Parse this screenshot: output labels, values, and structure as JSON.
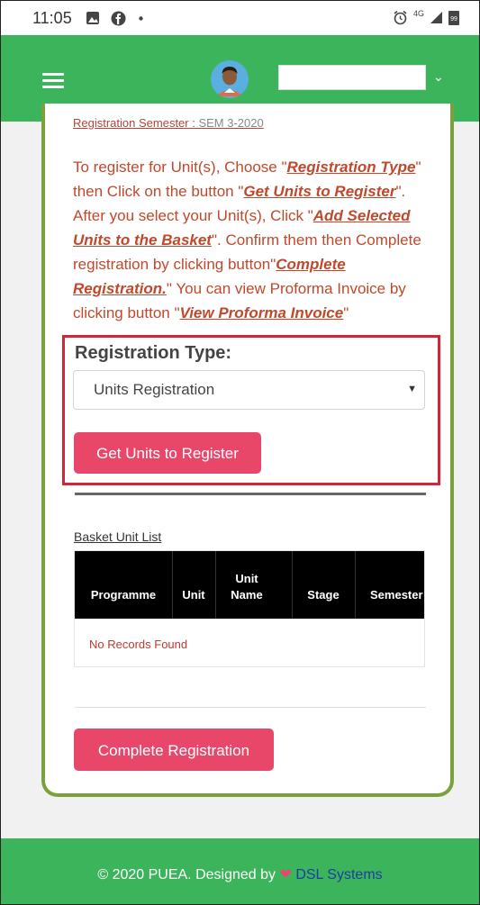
{
  "status_bar": {
    "time": "11:05",
    "network": "4G",
    "battery": "99",
    "icons": [
      "image-icon",
      "facebook-icon",
      "dot-icon",
      "alarm-icon",
      "signal-icon",
      "battery-icon"
    ]
  },
  "header": {
    "menu_icon": "hamburger-icon",
    "avatar_icon": "avatar-icon",
    "dropdown_icon": "chevron-down-icon",
    "user_value": ""
  },
  "registration": {
    "semester_label": "Registration Semester :",
    "semester_value": "SEM 3-2020",
    "instructions": {
      "p1": "To register for Unit(s), Choose \"",
      "link1": "Registration Type",
      "p2": "\" then Click on the button \"",
      "link2": "Get Units to Register",
      "p3": "\". After you select your Unit(s), Click \"",
      "link3": "Add Selected Units to the Basket",
      "p4": "\". Confirm them then Complete registration by clicking button\"",
      "link4": "Complete Registration.",
      "p5": "\" You can view Proforma Invoice by clicking button \"",
      "link5": "View Proforma Invoice",
      "p6": "\""
    },
    "type_label": "Registration Type:",
    "type_selected": "Units Registration",
    "get_units_button": "Get Units to Register"
  },
  "basket": {
    "title": "Basket Unit List",
    "columns": [
      "Programme",
      "Unit",
      "Unit Name",
      "Stage",
      "Semester"
    ],
    "empty_message": "No Records Found"
  },
  "actions": {
    "complete_button": "Complete Registration"
  },
  "footer": {
    "text_before": "© 2020 PUEA. Designed by",
    "brand": "DSL Systems"
  },
  "colors": {
    "header_green": "#3cb45b",
    "card_border": "#7aa13e",
    "button_pink": "#e9476a",
    "highlight_red": "#d0263a",
    "instruction_text": "#c0492c"
  }
}
